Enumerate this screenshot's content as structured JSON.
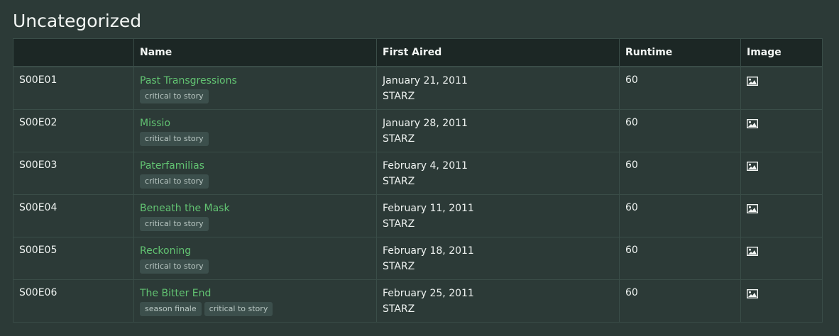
{
  "section": {
    "title": "Uncategorized"
  },
  "table": {
    "headers": [
      "",
      "Name",
      "First Aired",
      "Runtime",
      "Image"
    ],
    "rows": [
      {
        "episode": "S00E01",
        "name": "Past Transgressions",
        "tags": [
          "critical to story"
        ],
        "aired": "January 21, 2011",
        "network": "STARZ",
        "runtime": "60",
        "image_icon": "image-icon"
      },
      {
        "episode": "S00E02",
        "name": "Missio",
        "tags": [
          "critical to story"
        ],
        "aired": "January 28, 2011",
        "network": "STARZ",
        "runtime": "60",
        "image_icon": "image-icon"
      },
      {
        "episode": "S00E03",
        "name": "Paterfamilias",
        "tags": [
          "critical to story"
        ],
        "aired": "February 4, 2011",
        "network": "STARZ",
        "runtime": "60",
        "image_icon": "image-icon"
      },
      {
        "episode": "S00E04",
        "name": "Beneath the Mask",
        "tags": [
          "critical to story"
        ],
        "aired": "February 11, 2011",
        "network": "STARZ",
        "runtime": "60",
        "image_icon": "image-icon"
      },
      {
        "episode": "S00E05",
        "name": "Reckoning",
        "tags": [
          "critical to story"
        ],
        "aired": "February 18, 2011",
        "network": "STARZ",
        "runtime": "60",
        "image_icon": "image-icon"
      },
      {
        "episode": "S00E06",
        "name": "The Bitter End",
        "tags": [
          "season finale",
          "critical to story"
        ],
        "aired": "February 25, 2011",
        "network": "STARZ",
        "runtime": "60",
        "image_icon": "image-icon"
      }
    ]
  },
  "colors": {
    "background": "#2c3a37",
    "header_bg": "#1c2725",
    "link": "#62c372",
    "tag_bg": "#3c4f4c",
    "border": "#3a4d48"
  }
}
